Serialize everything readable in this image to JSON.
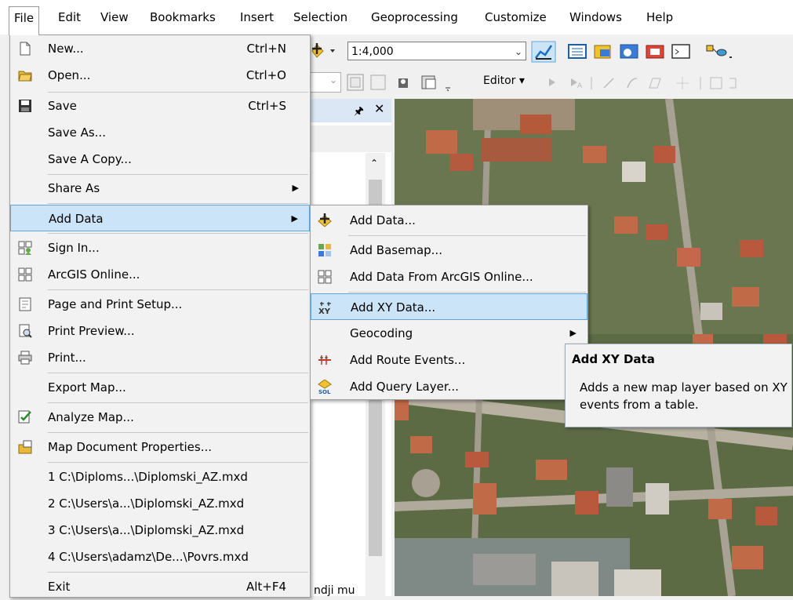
{
  "menubar": [
    "File",
    "Edit",
    "View",
    "Bookmarks",
    "Insert",
    "Selection",
    "Geoprocessing",
    "Customize",
    "Windows",
    "Help"
  ],
  "toolbar": {
    "scale": "1:4,000",
    "editor_label": "Editor"
  },
  "panel": {
    "bottom_fragment": "ndji mu"
  },
  "file_menu": {
    "new": {
      "label": "New...",
      "shortcut": "Ctrl+N"
    },
    "open": {
      "label": "Open...",
      "shortcut": "Ctrl+O"
    },
    "save": {
      "label": "Save",
      "shortcut": "Ctrl+S"
    },
    "save_as": {
      "label": "Save As..."
    },
    "save_copy": {
      "label": "Save A Copy..."
    },
    "share_as": {
      "label": "Share As"
    },
    "add_data": {
      "label": "Add Data"
    },
    "sign_in": {
      "label": "Sign In..."
    },
    "arcgis_online": {
      "label": "ArcGIS Online..."
    },
    "page_setup": {
      "label": "Page and Print Setup..."
    },
    "print_preview": {
      "label": "Print Preview..."
    },
    "print": {
      "label": "Print..."
    },
    "export_map": {
      "label": "Export Map..."
    },
    "analyze_map": {
      "label": "Analyze Map..."
    },
    "map_doc_props": {
      "label": "Map Document Properties..."
    },
    "recent": [
      "1 C:\\Diploms...\\Diplomski_AZ.mxd",
      "2 C:\\Users\\a...\\Diplomski_AZ.mxd",
      "3 C:\\Users\\a...\\Diplomski_AZ.mxd",
      "4 C:\\Users\\adamz\\De...\\Povrs.mxd"
    ],
    "exit": {
      "label": "Exit",
      "shortcut": "Alt+F4"
    }
  },
  "add_data_submenu": [
    "Add Data...",
    "Add Basemap...",
    "Add Data From ArcGIS Online...",
    "Add XY Data...",
    "Geocoding",
    "Add Route Events...",
    "Add Query Layer..."
  ],
  "tooltip": {
    "title": "Add XY Data",
    "body": "Adds a new map layer based on XY events from a table."
  },
  "colors": {
    "highlight": "#cce4f7",
    "highlight_border": "#5ea6dd",
    "menu_bg": "#f2f2f2"
  }
}
